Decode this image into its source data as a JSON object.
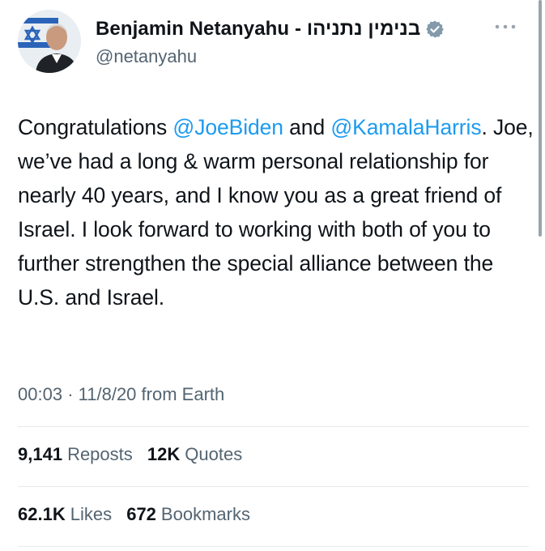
{
  "tweet": {
    "author": {
      "display_name": "Benjamin Netanyahu - בנימין נתניהו",
      "handle": "@netanyahu",
      "verified": true
    },
    "text": {
      "seg1": "Congratulations ",
      "mention1": "@JoeBiden",
      "seg2": " and ",
      "mention2": "@KamalaHarris",
      "seg3": ". Joe, we’ve had a long & warm personal relationship for nearly 40 years, and I know you as a great friend of Israel. I look forward to working with both of you to further strengthen the special alliance between the U.S. and Israel."
    },
    "meta": {
      "time": "00:03",
      "separator": "·",
      "date": "11/8/20",
      "source": "from Earth"
    },
    "stats": {
      "reposts_count": "9,141",
      "reposts_label": "Reposts",
      "quotes_count": "12K",
      "quotes_label": "Quotes",
      "likes_count": "62.1K",
      "likes_label": "Likes",
      "bookmarks_count": "672",
      "bookmarks_label": "Bookmarks"
    }
  },
  "icons": {
    "verified": "verified-badge-icon",
    "more": "more-options-icon"
  },
  "colors": {
    "text": "#0f1419",
    "secondary": "#536471",
    "link": "#1d9bf0",
    "divider": "#e7e9ea"
  }
}
